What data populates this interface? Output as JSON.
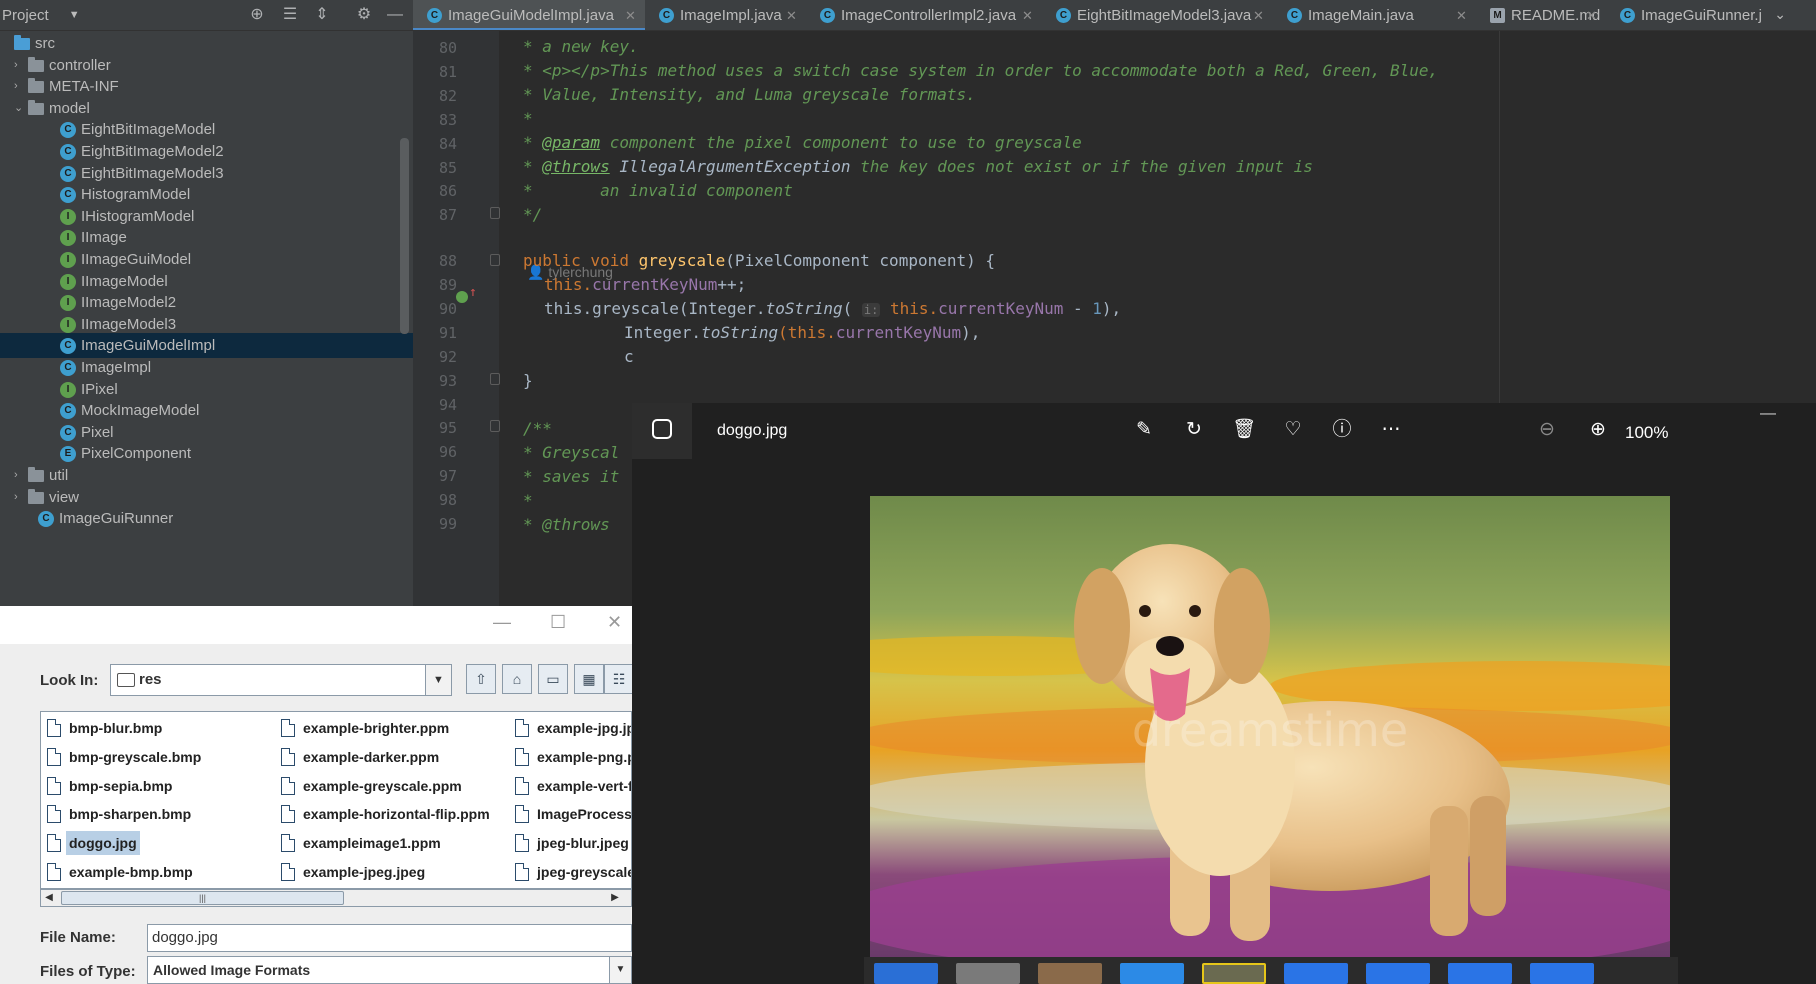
{
  "ide": {
    "project_title": "Project",
    "tree": [
      {
        "label": "src",
        "kind": "srcfolder",
        "depth": 0,
        "expanded": true
      },
      {
        "label": "controller",
        "kind": "folder",
        "depth": 1,
        "expanded": false
      },
      {
        "label": "META-INF",
        "kind": "folder",
        "depth": 1,
        "expanded": false
      },
      {
        "label": "model",
        "kind": "folder",
        "depth": 1,
        "expanded": true
      },
      {
        "label": "EightBitImageModel",
        "kind": "C",
        "depth": 2
      },
      {
        "label": "EightBitImageModel2",
        "kind": "C",
        "depth": 2
      },
      {
        "label": "EightBitImageModel3",
        "kind": "C",
        "depth": 2
      },
      {
        "label": "HistogramModel",
        "kind": "C",
        "depth": 2
      },
      {
        "label": "IHistogramModel",
        "kind": "I",
        "depth": 2
      },
      {
        "label": "IImage",
        "kind": "I",
        "depth": 2
      },
      {
        "label": "IImageGuiModel",
        "kind": "I",
        "depth": 2
      },
      {
        "label": "IImageModel",
        "kind": "I",
        "depth": 2
      },
      {
        "label": "IImageModel2",
        "kind": "I",
        "depth": 2
      },
      {
        "label": "IImageModel3",
        "kind": "I",
        "depth": 2
      },
      {
        "label": "ImageGuiModelImpl",
        "kind": "C",
        "depth": 2,
        "selected": true
      },
      {
        "label": "ImageImpl",
        "kind": "C",
        "depth": 2
      },
      {
        "label": "IPixel",
        "kind": "I",
        "depth": 2
      },
      {
        "label": "MockImageModel",
        "kind": "C",
        "depth": 2
      },
      {
        "label": "Pixel",
        "kind": "C",
        "depth": 2
      },
      {
        "label": "PixelComponent",
        "kind": "E",
        "depth": 2
      },
      {
        "label": "util",
        "kind": "folder",
        "depth": 1,
        "expanded": false
      },
      {
        "label": "view",
        "kind": "folder",
        "depth": 1,
        "expanded": false
      },
      {
        "label": "ImageGuiRunner",
        "kind": "C",
        "depth": 1
      }
    ],
    "tabs": [
      {
        "label": "ImageGuiModelImpl.java",
        "active": true
      },
      {
        "label": "ImageImpl.java"
      },
      {
        "label": "ImageControllerImpl2.java"
      },
      {
        "label": "EightBitImageModel3.java"
      },
      {
        "label": "ImageMain.java"
      },
      {
        "label": "README.md",
        "md": true
      },
      {
        "label": "ImageGuiRunner.j"
      }
    ],
    "author_hint": "tylerchung",
    "line_numbers": [
      "80",
      "81",
      "82",
      "83",
      "84",
      "85",
      "86",
      "87",
      "88",
      "89",
      "90",
      "91",
      "92",
      "93",
      "94",
      "95",
      "96",
      "97",
      "98",
      "99"
    ],
    "code": {
      "l80": "* a new key.",
      "l81": "* <p></p>This method uses a switch case system in order to accommodate both a Red, Green, Blue,",
      "l82": "* Value, Intensity, and Luma greyscale formats.",
      "l83": "*",
      "l84_tag": "@param",
      "l84_rest": " component the pixel component to use to greyscale",
      "l85_tag": "@throws",
      "l85_type": " IllegalArgumentException",
      "l85_rest": " the key does not exist or if the given input is",
      "l86": "*       an invalid component",
      "l87": "*/",
      "l88_mods": "public void ",
      "l88_name": "greyscale",
      "l88_params": "(PixelComponent component) {",
      "l89_this": "this.",
      "l89_field": "currentKeyNum",
      "l89_rest": "++;",
      "l90_a": "this.greyscale(Integer.",
      "l90_b": "toString",
      "l90_c": "( ",
      "l90_hint": "i:",
      "l90_d": " this.",
      "l90_field": "currentKeyNum",
      "l90_e": " - ",
      "l90_num": "1",
      "l90_f": "),",
      "l91_a": "Integer.",
      "l91_b": "toString",
      "l91_c": "(this.",
      "l91_field": "currentKeyNum",
      "l91_d": "),",
      "l92": "c",
      "l93": "}",
      "l95": "/**",
      "l96": "* Greyscal",
      "l97": "* saves it",
      "l98": "*",
      "l99": "* @throws"
    }
  },
  "file_dialog": {
    "look_in_label": "Look In:",
    "look_in_value": "res",
    "files": [
      [
        "bmp-blur.bmp",
        "bmp-greyscale.bmp",
        "bmp-sepia.bmp",
        "bmp-sharpen.bmp",
        "doggo.jpg",
        "example-bmp.bmp"
      ],
      [
        "example-brighter.ppm",
        "example-darker.ppm",
        "example-greyscale.ppm",
        "example-horizontal-flip.ppm",
        "exampleimage1.ppm",
        "example-jpeg.jpeg"
      ],
      [
        "example-jpg.jpg",
        "example-png.png",
        "example-vert-flip",
        "ImageProcessing",
        "jpeg-blur.jpeg",
        "jpeg-greyscale.jp"
      ]
    ],
    "selected_file": "doggo.jpg",
    "file_name_label": "File Name:",
    "file_name_value": "doggo.jpg",
    "files_of_type_label": "Files of Type:",
    "files_of_type_value": "Allowed Image Formats",
    "scroll_thumb": "|||"
  },
  "viewer": {
    "filename": "doggo.jpg",
    "zoom": "100%",
    "tools": [
      "edit-icon",
      "rotate-icon",
      "delete-icon",
      "favorite-icon",
      "info-icon",
      "more-icon"
    ],
    "zoom_tools": [
      "zoom-out-icon",
      "zoom-in-icon"
    ],
    "watermark": "dreamstime",
    "filmstrip_selected_index": 4,
    "filmstrip_count": 9
  }
}
